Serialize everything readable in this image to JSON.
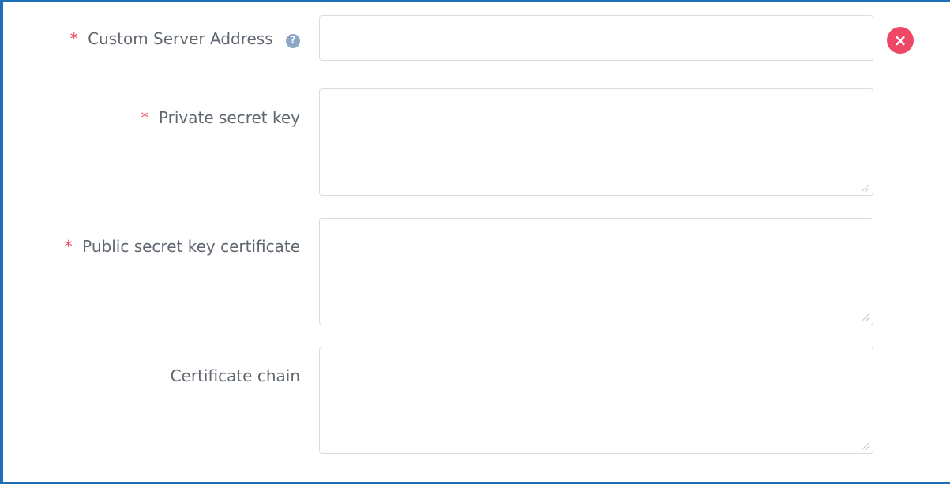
{
  "form": {
    "fields": [
      {
        "label": "Custom Server Address",
        "required": true,
        "value": ""
      },
      {
        "label": "Private secret key",
        "required": true,
        "value": ""
      },
      {
        "label": "Public secret key certificate",
        "required": true,
        "value": ""
      },
      {
        "label": "Certificate chain",
        "required": false,
        "value": ""
      }
    ],
    "required_marker": "*",
    "help_icon": "question-circle-icon",
    "clear_icon": "close-circle-icon",
    "help_glyph": "?",
    "clear_glyph": "×"
  },
  "colors": {
    "frame_border": "#1f6fb8",
    "required_marker": "#f04a5c",
    "label_text": "#5f6770",
    "input_border": "#d9dde2",
    "clear_button": "#ee4866",
    "help_icon": "#8da8c6"
  }
}
